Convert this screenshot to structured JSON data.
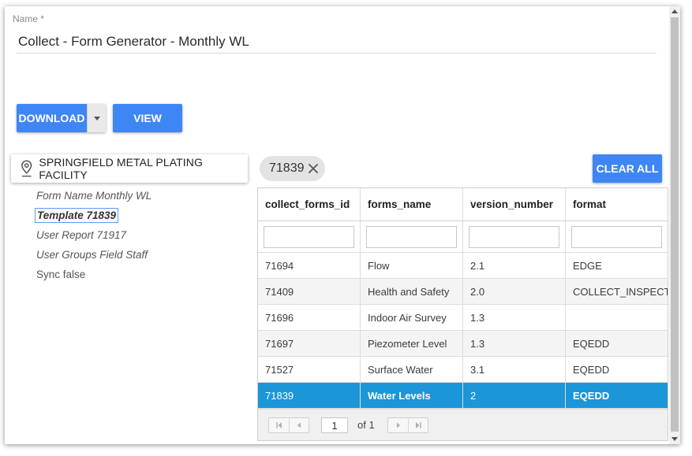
{
  "form": {
    "name_label": "Name *",
    "name_value": "Collect - Form Generator - Monthly WL"
  },
  "toolbar": {
    "download_label": "DOWNLOAD",
    "view_label": "VIEW",
    "clear_all_label": "CLEAR ALL"
  },
  "facility": {
    "icon": "location-pin-icon",
    "name": "SPRINGFIELD METAL PLATING FACILITY"
  },
  "meta": {
    "form_name": "Form Name Monthly WL",
    "template": "Template 71839",
    "user_report": "User Report 71917",
    "user_groups": "User Groups Field Staff",
    "sync": "Sync false"
  },
  "chip": {
    "label": "71839"
  },
  "grid": {
    "columns": [
      "collect_forms_id",
      "forms_name",
      "version_number",
      "format"
    ],
    "rows": [
      [
        "71694",
        "Flow",
        "2.1",
        "EDGE"
      ],
      [
        "71409",
        "Health and Safety",
        "2.0",
        "COLLECT_INSPECTION"
      ],
      [
        "71696",
        "Indoor Air Survey",
        "1.3",
        ""
      ],
      [
        "71697",
        "Piezometer Level",
        "1.3",
        "EQEDD"
      ],
      [
        "71527",
        "Surface Water",
        "3.1",
        "EQEDD"
      ],
      [
        "71839",
        "Water Levels",
        "2",
        "EQEDD"
      ]
    ],
    "selected_row": 5
  },
  "pager": {
    "page": "1",
    "of_label": "of 1"
  },
  "colors": {
    "accent": "#3f86f5",
    "selected_row": "#1b96d8"
  }
}
